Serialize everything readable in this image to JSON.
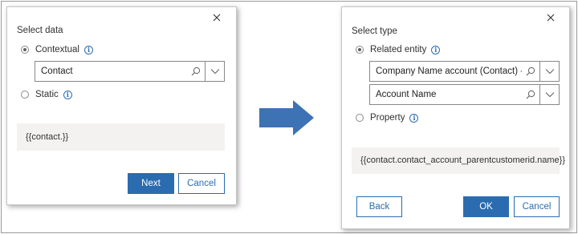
{
  "dialog1": {
    "title": "Select data",
    "contextual_label": "Contextual",
    "contextual_value": "Contact",
    "static_label": "Static",
    "result": "{{contact.}}",
    "next_label": "Next",
    "cancel_label": "Cancel"
  },
  "dialog2": {
    "title": "Select type",
    "related_entity_label": "Related entity",
    "entity_value": "Company Name account (Contact) -> Account",
    "field_value": "Account Name",
    "property_label": "Property",
    "result": "{{contact.contact_account_parentcustomerid.name}}",
    "back_label": "Back",
    "ok_label": "OK",
    "cancel_label": "Cancel"
  },
  "colors": {
    "primary": "#2b6cb0",
    "arrow": "#3d72b4",
    "result_bg": "#f3f2f1"
  },
  "icons": [
    "close-icon",
    "info-icon",
    "search-icon",
    "chevron-down-icon",
    "right-arrow"
  ]
}
